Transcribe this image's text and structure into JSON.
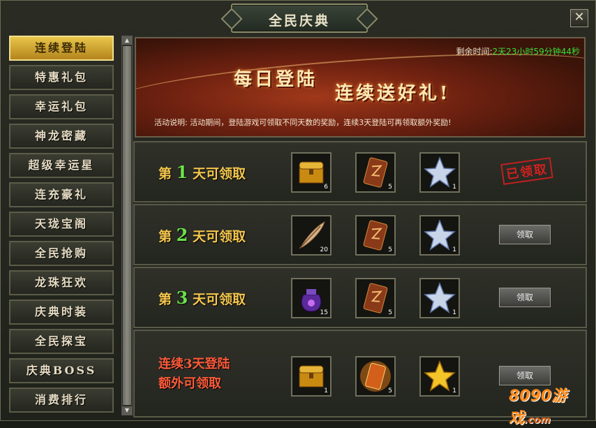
{
  "window": {
    "title": "全民庆典",
    "close_symbol": "✕"
  },
  "sidebar": {
    "items": [
      {
        "label": "连续登陆",
        "active": true
      },
      {
        "label": "特惠礼包"
      },
      {
        "label": "幸运礼包"
      },
      {
        "label": "神龙密藏"
      },
      {
        "label": "超级幸运星"
      },
      {
        "label": "连充豪礼"
      },
      {
        "label": "天珑宝阁"
      },
      {
        "label": "全民抢购"
      },
      {
        "label": "龙珠狂欢"
      },
      {
        "label": "庆典时装"
      },
      {
        "label": "全民探宝"
      },
      {
        "label": "庆典BOSS"
      },
      {
        "label": "消费排行"
      }
    ]
  },
  "banner": {
    "title_1": "每日登陆",
    "title_2": "连续送好礼!",
    "remaining_label": "剩余时间:",
    "remaining_value": "2天23小时59分钟44秒",
    "description": "活动说明: 活动期间，登陆游戏可领取不同天数的奖励，连续3天登陆可再领取额外奖励!"
  },
  "rows": [
    {
      "prefix": "第",
      "day": "1",
      "suffix": "天可领取",
      "items": [
        {
          "icon": "gold-chest-icon",
          "count": "6"
        },
        {
          "icon": "rune-scroll-icon",
          "count": "5"
        },
        {
          "icon": "silver-star-icon",
          "count": "1"
        }
      ],
      "status": "已领取"
    },
    {
      "prefix": "第",
      "day": "2",
      "suffix": "天可领取",
      "items": [
        {
          "icon": "feather-icon",
          "count": "20"
        },
        {
          "icon": "rune-scroll-icon",
          "count": "5"
        },
        {
          "icon": "silver-star-icon",
          "count": "1"
        }
      ],
      "button": "领取"
    },
    {
      "prefix": "第",
      "day": "3",
      "suffix": "天可领取",
      "items": [
        {
          "icon": "purple-pouch-icon",
          "count": "15"
        },
        {
          "icon": "rune-scroll-icon",
          "count": "5"
        },
        {
          "icon": "silver-star-icon",
          "count": "1"
        }
      ],
      "button": "领取"
    }
  ],
  "bonus": {
    "line1": "连续3天登陆",
    "line2": "额外可领取",
    "items": [
      {
        "icon": "gold-chest-icon",
        "count": "1"
      },
      {
        "icon": "glowing-rune-icon",
        "count": "5"
      },
      {
        "icon": "gold-star-icon",
        "count": "1"
      }
    ],
    "button": "领取"
  },
  "watermark": {
    "text": "8090游戏",
    "sub": ".com"
  }
}
